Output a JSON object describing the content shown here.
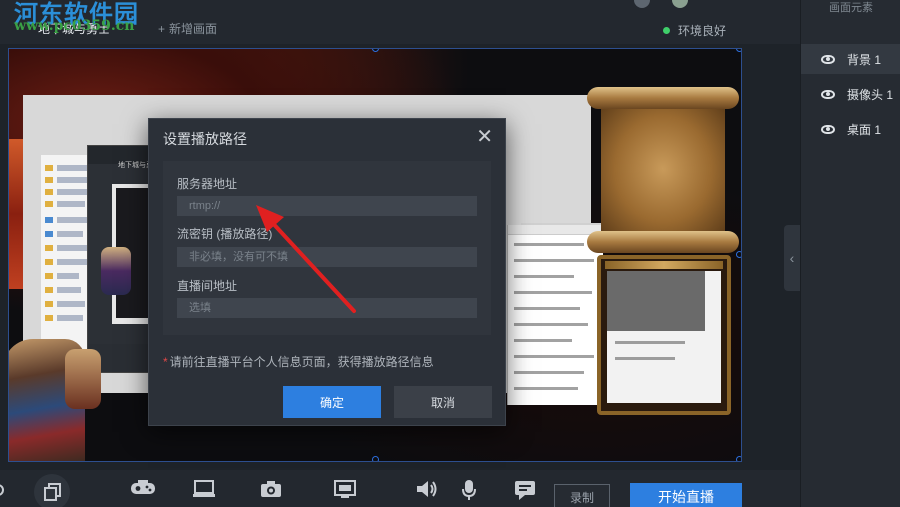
{
  "watermark": {
    "title": "河东软件园",
    "url": "www.pc0359.cn"
  },
  "topbar": {
    "scene_tab": "地下城与勇士",
    "add_scene": "新增画面",
    "add_icon": "+",
    "env_status": "环境良好"
  },
  "right_panel": {
    "title": "画面元素",
    "items": [
      {
        "label": "背景 1",
        "icon": "eye-icon"
      },
      {
        "label": "摄像头 1",
        "icon": "eye-icon"
      },
      {
        "label": "桌面 1",
        "icon": "eye-icon"
      }
    ],
    "collapse_glyph": "‹"
  },
  "inner_app": {
    "tab_label": "地下城与勇士"
  },
  "dialog": {
    "title": "设置播放路径",
    "close_glyph": "✕",
    "fields": [
      {
        "label": "服务器地址",
        "placeholder": "rtmp://"
      },
      {
        "label": "流密钥 (播放路径)",
        "placeholder": "非必填，没有可不填"
      },
      {
        "label": "直播间地址",
        "placeholder": "选填"
      }
    ],
    "hint_star": "*",
    "hint": "请前往直播平台个人信息页面，获得播放路径信息",
    "ok_label": "确定",
    "cancel_label": "取消"
  },
  "bottombar": {
    "icons": [
      "layers-icon",
      "gamepad-icon",
      "monitor-icon",
      "camera-icon",
      "screen-cast-icon",
      "speaker-icon",
      "microphone-icon",
      "chat-icon"
    ],
    "record_label": "录制",
    "live_label": "开始直播"
  },
  "colors": {
    "accent": "#2d7fe0",
    "arrow": "#e02020",
    "status_ok": "#3fcf6a",
    "hint_star": "#e04848"
  }
}
